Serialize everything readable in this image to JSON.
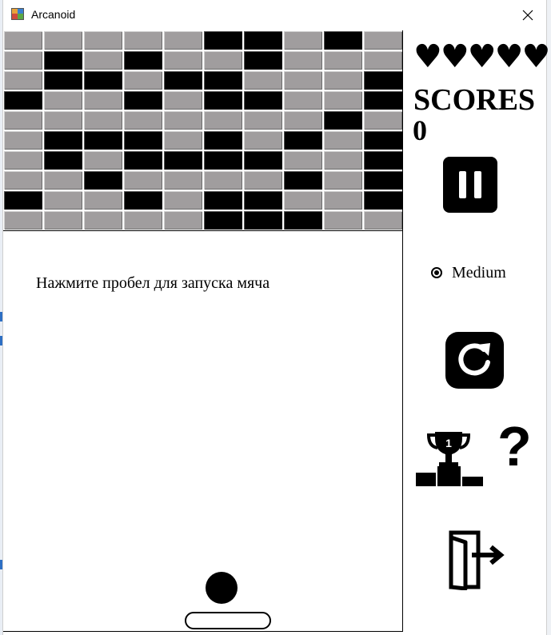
{
  "window": {
    "title": "Arcanoid",
    "close_glyph": "✕"
  },
  "game": {
    "bricks_grid": [
      [
        "gray",
        "gray",
        "gray",
        "gray",
        "gray",
        "black",
        "black",
        "gray",
        "black",
        "gray"
      ],
      [
        "gray",
        "black",
        "gray",
        "black",
        "gray",
        "gray",
        "black",
        "gray",
        "gray",
        "gray"
      ],
      [
        "gray",
        "black",
        "black",
        "gray",
        "black",
        "black",
        "gray",
        "gray",
        "gray",
        "black"
      ],
      [
        "black",
        "gray",
        "gray",
        "black",
        "gray",
        "black",
        "black",
        "gray",
        "gray",
        "black"
      ],
      [
        "gray",
        "gray",
        "gray",
        "gray",
        "gray",
        "gray",
        "gray",
        "gray",
        "black",
        "gray"
      ],
      [
        "gray",
        "black",
        "black",
        "black",
        "gray",
        "black",
        "gray",
        "black",
        "gray",
        "black"
      ],
      [
        "gray",
        "black",
        "gray",
        "black",
        "black",
        "black",
        "black",
        "gray",
        "gray",
        "black"
      ],
      [
        "gray",
        "gray",
        "black",
        "gray",
        "gray",
        "gray",
        "gray",
        "black",
        "gray",
        "black"
      ],
      [
        "black",
        "gray",
        "gray",
        "black",
        "gray",
        "black",
        "black",
        "gray",
        "gray",
        "black"
      ],
      [
        "gray",
        "gray",
        "gray",
        "gray",
        "gray",
        "black",
        "black",
        "black",
        "gray",
        "gray"
      ]
    ],
    "hint": "Нажмите пробел для запуска мяча"
  },
  "sidebar": {
    "lives": "♥♥♥♥♥",
    "scores_label": "SCORES",
    "scores_value": "0",
    "difficulty_label": "Medium",
    "icons": {
      "pause": "pause-icon",
      "restart": "restart-icon",
      "leaderboard": "trophy-podium-icon",
      "help": "?",
      "exit": "exit-door-icon"
    }
  }
}
